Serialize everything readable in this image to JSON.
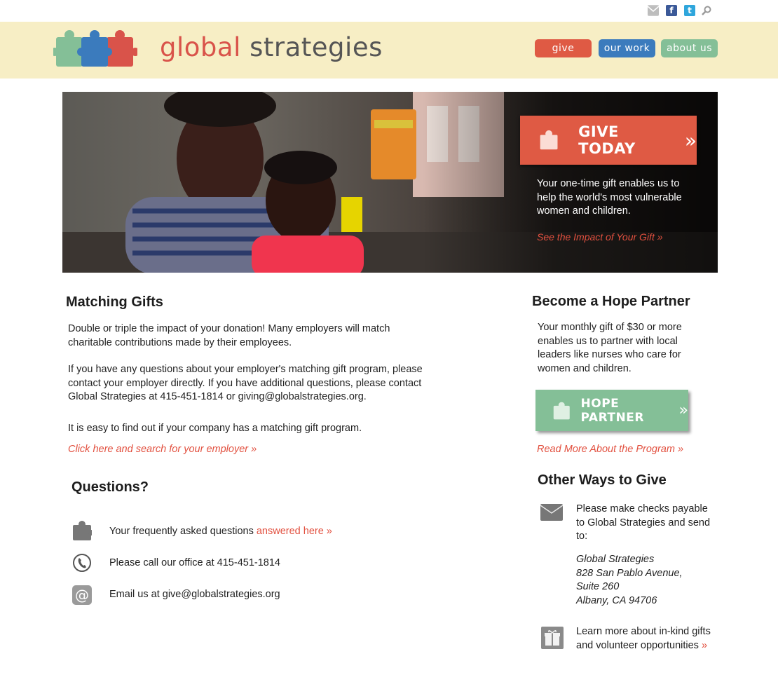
{
  "top_icons": {
    "mail": "mail-icon",
    "facebook": "facebook-icon",
    "facebook_glyph": "f",
    "twitter": "twitter-icon",
    "twitter_glyph": "t",
    "search": "search-icon"
  },
  "brand": {
    "name_part1": "global",
    "name_part2": "strategies",
    "colors": {
      "red": "#d9534a",
      "blue": "#3b7bbd",
      "green": "#84bf97",
      "band": "#f7eec5"
    }
  },
  "nav": {
    "give": "give",
    "our_work": "our work",
    "about_us": "about us"
  },
  "hero": {
    "cta_label": "GIVE TODAY",
    "cta_chevron": "»",
    "text": "Your one-time gift enables us to help the world's most vulnerable women and children.",
    "impact_link": "See the Impact of Your Gift »"
  },
  "matching": {
    "title": "Matching Gifts",
    "p1": "Double or triple the impact of your donation! Many employers will match charitable contributions made by their employees.",
    "p2": "If you have any questions about your employer's matching gift program, please contact your employer directly. If you have additional questions, please contact Global Strategies at 415-451-1814 or giving@globalstrategies.org.",
    "p3": "It is easy to  find out if your company has a matching gift program.",
    "search_link": "Click here and search for your employer »"
  },
  "questions": {
    "title": "Questions?",
    "faq_text": "Your frequently asked questions ",
    "faq_link": "answered here »",
    "call_text": "Please call our office at 415-451-1814",
    "email_text": "Email us at give@globalstrategies.org",
    "email_glyph": "@"
  },
  "hope": {
    "title": "Become a Hope Partner",
    "text": "Your monthly gift of $30 or more enables us to partner with local leaders like nurses who care for women and children.",
    "button_label": "HOPE PARTNER",
    "button_chevron": "»",
    "read_more": "Read More About the Program »"
  },
  "other_ways": {
    "title": "Other Ways to Give",
    "checks_text": "Please make checks payable to Global Strategies and send to:",
    "address": {
      "line1": "Global Strategies",
      "line2": "828 San Pablo Avenue,",
      "line3": "Suite 260",
      "line4": "Albany, CA 94706"
    },
    "inkind_text": "Learn more about in-kind gifts and volunteer opportunities ",
    "inkind_link": "»"
  }
}
